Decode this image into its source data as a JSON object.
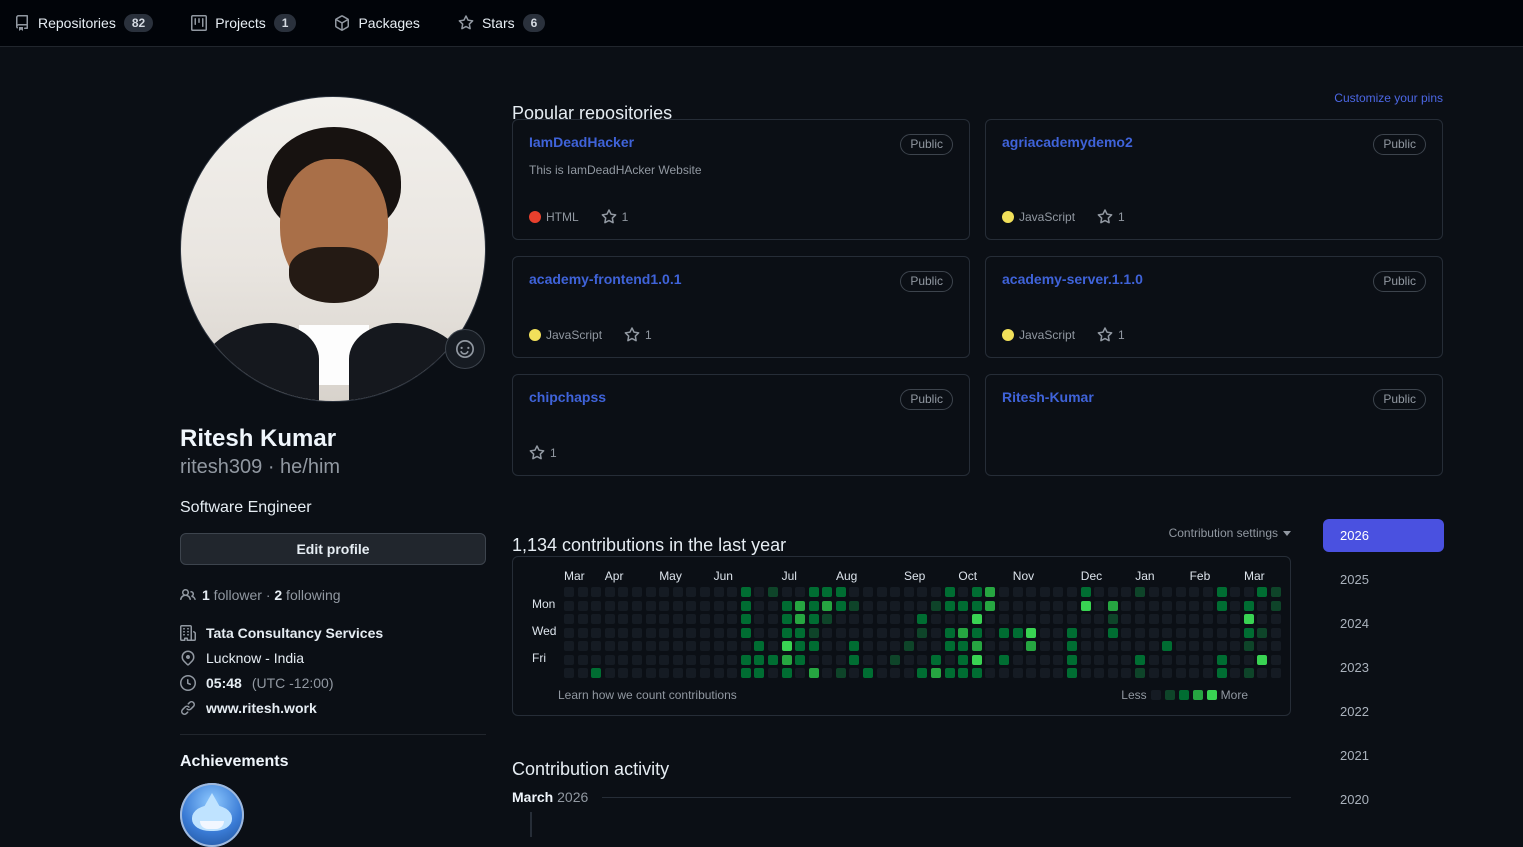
{
  "colors": {
    "background": "#0b0f15",
    "nav_background": "#010409",
    "link_blue": "#3f63d9",
    "selected_year_button": "#4a51e0",
    "html_language": "#e8402d",
    "javascript_language": "#f1e05a",
    "muted_text": "#9198a1"
  },
  "nav": {
    "items": [
      {
        "label": "Repositories",
        "count": "82",
        "icon": "repo-icon"
      },
      {
        "label": "Projects",
        "count": "1",
        "icon": "project-icon"
      },
      {
        "label": "Packages",
        "count": "",
        "icon": "package-icon"
      },
      {
        "label": "Stars",
        "count": "6",
        "icon": "star-icon"
      }
    ]
  },
  "profile": {
    "name": "Ritesh Kumar",
    "username_line": "ritesh309 · he/him",
    "bio": "Software Engineer",
    "edit_button": "Edit profile",
    "followers_count": "1",
    "followers_label": " follower",
    "separator": " · ",
    "following_count": "2",
    "following_label": " following",
    "details": [
      {
        "icon": "organization-icon",
        "text": "Tata Consultancy Services",
        "bold": true,
        "link": false
      },
      {
        "icon": "location-icon",
        "text": "Lucknow - India",
        "bold": false,
        "link": false
      },
      {
        "icon": "clock-icon",
        "text": "05:48",
        "suffix": " (UTC -12:00)",
        "bold": true,
        "link": false
      },
      {
        "icon": "link-icon",
        "text": "www.ritesh.work",
        "bold": true,
        "link": true
      }
    ],
    "achievements_title": "Achievements",
    "achievement_badge": "pull-shark"
  },
  "popular": {
    "title": "Popular repositories",
    "customize_link": "Customize your pins",
    "repos": [
      {
        "name": "IamDeadHacker",
        "visibility": "Public",
        "description": "This is IamDeadHAcker Website",
        "language": "HTML",
        "language_color": "#e8402d",
        "stars": "1"
      },
      {
        "name": "agriacademydemo2",
        "visibility": "Public",
        "description": "",
        "language": "JavaScript",
        "language_color": "#f1e05a",
        "stars": "1"
      },
      {
        "name": "academy-frontend1.0.1",
        "visibility": "Public",
        "description": "",
        "language": "JavaScript",
        "language_color": "#f1e05a",
        "stars": "1"
      },
      {
        "name": "academy-server.1.1.0",
        "visibility": "Public",
        "description": "",
        "language": "JavaScript",
        "language_color": "#f1e05a",
        "stars": "1"
      },
      {
        "name": "chipchapss",
        "visibility": "Public",
        "description": "",
        "language": "",
        "language_color": "",
        "stars": "1"
      },
      {
        "name": "Ritesh-Kumar",
        "visibility": "Public",
        "description": "",
        "language": "",
        "language_color": "",
        "stars": ""
      }
    ]
  },
  "contributions": {
    "title": "1,134 contributions in the last year",
    "settings_label": "Contribution settings",
    "footer_link": "Learn how we count contributions",
    "legend_less": "Less",
    "legend_more": "More"
  },
  "chart_data": {
    "type": "heatmap",
    "title": "1,134 contributions in the last year",
    "total_contributions": 1134,
    "weeks": 53,
    "months": [
      "Mar",
      "Apr",
      "May",
      "Jun",
      "Jul",
      "Aug",
      "Sep",
      "Oct",
      "Nov",
      "Dec",
      "Jan",
      "Feb",
      "Mar"
    ],
    "month_start_columns": [
      0,
      3,
      7,
      11,
      16,
      20,
      25,
      29,
      33,
      38,
      42,
      46,
      50
    ],
    "day_labels": [
      "Mon",
      "Wed",
      "Fri"
    ],
    "day_label_rows": [
      1,
      3,
      5
    ],
    "level_colors": [
      "#151b23",
      "#0e4429",
      "#006d32",
      "#26a641",
      "#39d353"
    ],
    "legend_levels": [
      0,
      1,
      2,
      3,
      4
    ],
    "grid_rows_levels": [
      "00000000000002010022200000002023000000200010000020021",
      "00000000000002002323210000012223000000403000000020201",
      "00000000000002002321000000200040000000001000000000400",
      "00000000000002002210000000102320224002002000000000210",
      "00000000000000204220020001002230003002000000200000100",
      "00000000000002223200020010020240200002000020000020040",
      "00200000000002202030102000232220000002000010000020100"
    ]
  },
  "years": {
    "selected": "2026",
    "items": [
      "2026",
      "2025",
      "2024",
      "2023",
      "2022",
      "2021",
      "2020"
    ]
  },
  "activity": {
    "title": "Contribution activity",
    "month": "March",
    "year": "2026"
  }
}
